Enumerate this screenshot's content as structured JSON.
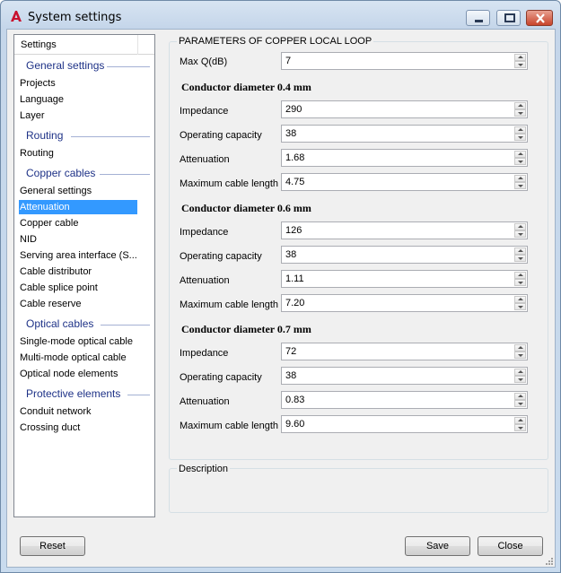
{
  "window": {
    "title": "System settings"
  },
  "sidebar": {
    "header": "Settings",
    "groups": [
      {
        "label": "General settings",
        "items": [
          "Projects",
          "Language",
          "Layer"
        ]
      },
      {
        "label": "Routing",
        "items": [
          "Routing"
        ]
      },
      {
        "label": "Copper cables",
        "items": [
          "General settings",
          "Attenuation",
          "Copper cable",
          "NID",
          "Serving area interface (S...",
          "Cable distributor",
          "Cable splice point",
          "Cable reserve"
        ]
      },
      {
        "label": "Optical cables",
        "items": [
          "Single-mode optical cable",
          "Multi-mode optical cable",
          "Optical node elements"
        ]
      },
      {
        "label": "Protective elements",
        "items": [
          "Conduit network",
          "Crossing duct"
        ]
      }
    ],
    "selected": "Attenuation"
  },
  "params": {
    "legend": "PARAMETERS OF COPPER LOCAL LOOP",
    "max_q": {
      "label": "Max Q(dB)",
      "value": "7"
    },
    "sections": [
      {
        "heading": "Conductor diameter 0.4 mm",
        "fields": [
          {
            "label": "Impedance",
            "value": "290"
          },
          {
            "label": "Operating capacity",
            "value": "38"
          },
          {
            "label": "Attenuation",
            "value": "1.68"
          },
          {
            "label": "Maximum cable length",
            "value": "4.75"
          }
        ]
      },
      {
        "heading": "Conductor diameter 0.6 mm",
        "fields": [
          {
            "label": "Impedance",
            "value": "126"
          },
          {
            "label": "Operating capacity",
            "value": "38"
          },
          {
            "label": "Attenuation",
            "value": "1.11"
          },
          {
            "label": "Maximum cable length",
            "value": "7.20"
          }
        ]
      },
      {
        "heading": "Conductor diameter 0.7 mm",
        "fields": [
          {
            "label": "Impedance",
            "value": "72"
          },
          {
            "label": "Operating capacity",
            "value": "38"
          },
          {
            "label": "Attenuation",
            "value": "0.83"
          },
          {
            "label": "Maximum cable length",
            "value": "9.60"
          }
        ]
      }
    ]
  },
  "description": {
    "legend": "Description"
  },
  "buttons": {
    "reset": "Reset",
    "save": "Save",
    "close": "Close"
  },
  "colors": {
    "group_text": "#1e3287",
    "selection": "#3399ff",
    "close_button": "#c8442b"
  }
}
